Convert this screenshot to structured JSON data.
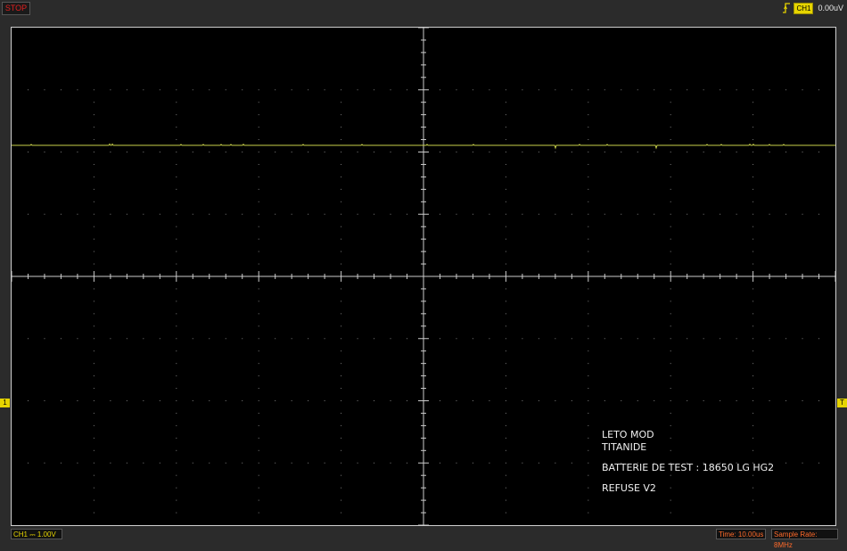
{
  "toolbar": {
    "stop_label": "STOP",
    "trigger_channel": "CH1",
    "trigger_level": "0.00uV"
  },
  "markers": {
    "left": "1",
    "right": "T"
  },
  "annotation": {
    "line1": "LETO MOD",
    "line2": "TITANIDE",
    "line3": "BATTERIE DE TEST : 18650 LG HG2",
    "line4": "REFUSE V2"
  },
  "status": {
    "ch1_scale": "CH1 ⎓ 1.00V",
    "time": "Time: 10.00us",
    "sample_rate": "Sample Rate: 8MHz"
  },
  "colors": {
    "trace": "#c8d04a",
    "grid": "#cccccc",
    "stop": "#e02020",
    "channel": "#e6d400",
    "readout": "#ff6a2a"
  }
}
